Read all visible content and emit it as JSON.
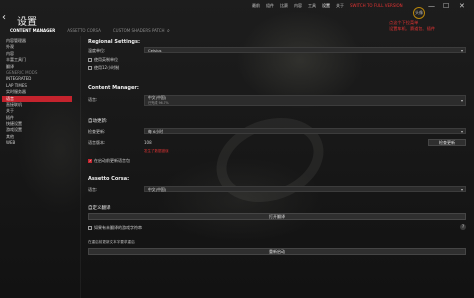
{
  "window": {
    "title": "设置",
    "back_icon": "back-arrow-icon",
    "controls": {
      "minimize": "—",
      "maximize": "☐",
      "close": "✕"
    }
  },
  "top_menu": [
    {
      "label": "最前",
      "state": "normal"
    },
    {
      "label": "组件",
      "state": "normal"
    },
    {
      "label": "比赛",
      "state": "normal"
    },
    {
      "label": "内容",
      "state": "normal"
    },
    {
      "label": "工具",
      "state": "normal"
    },
    {
      "label": "设置",
      "state": "active"
    },
    {
      "label": "关于",
      "state": "normal"
    },
    {
      "label": "SWITCH TO FULL VERSION",
      "state": "red"
    }
  ],
  "avatar": {
    "label": "头像"
  },
  "annotation": {
    "line1": "点这个下拉菜单",
    "line2": "设置车机、赛道包、插件"
  },
  "tabs": [
    {
      "label": "CONTENT MANAGER",
      "active": true
    },
    {
      "label": "ASSETTO CORSA",
      "active": false
    },
    {
      "label": "CUSTOM SHADERS PATCH",
      "active": false
    }
  ],
  "sidebar": [
    {
      "label": "内容管理器",
      "type": "item"
    },
    {
      "label": "外观",
      "type": "item"
    },
    {
      "label": "内容",
      "type": "item"
    },
    {
      "label": "丰富工具门",
      "type": "item"
    },
    {
      "label": "翻译",
      "type": "item"
    },
    {
      "label": "GENERIC MODS",
      "type": "header"
    },
    {
      "label": "INTEGRATED",
      "type": "item"
    },
    {
      "label": "LAP TIMES",
      "type": "item"
    },
    {
      "label": "实时服务器",
      "type": "item"
    },
    {
      "label": "语言",
      "type": "active"
    },
    {
      "label": "直接联机",
      "type": "item"
    },
    {
      "label": "关于",
      "type": "item"
    },
    {
      "label": "插件",
      "type": "item"
    },
    {
      "label": "快捷设置",
      "type": "item"
    },
    {
      "label": "游戏设置",
      "type": "item"
    },
    {
      "label": "其他",
      "type": "item"
    },
    {
      "label": "WEB",
      "type": "item"
    }
  ],
  "regional": {
    "title": "Regional Settings:",
    "unit_label": "温度单位:",
    "unit_value": "Celsius",
    "checkbox1": "使用英制单位",
    "checkbox2": "使用12小时制"
  },
  "content_manager": {
    "title": "Content Manager:",
    "language_label": "语言:",
    "language_value": "中文(中国)",
    "language_sub": "已完成 96.7%"
  },
  "auto_update": {
    "title": "自动更新:",
    "check_label": "检查更新:",
    "check_value": "每 6小时",
    "version_label": "语言版本:",
    "version_value": "108",
    "version_warning": "发生了数据错误",
    "check_button": "检查更新",
    "auto_update_checkbox": "在启动前更新语言包"
  },
  "assetto_corsa": {
    "title": "Assetto Corsa:",
    "language_label": "语言:",
    "language_value": "中文(中国)"
  },
  "custom_translation": {
    "title": "自定义翻译",
    "open_button": "打开翻译",
    "checkbox_label": "如果有未翻译的游戏字符串",
    "note": "在重启前更新文本字要求重启",
    "restart_button": "重新启动"
  }
}
